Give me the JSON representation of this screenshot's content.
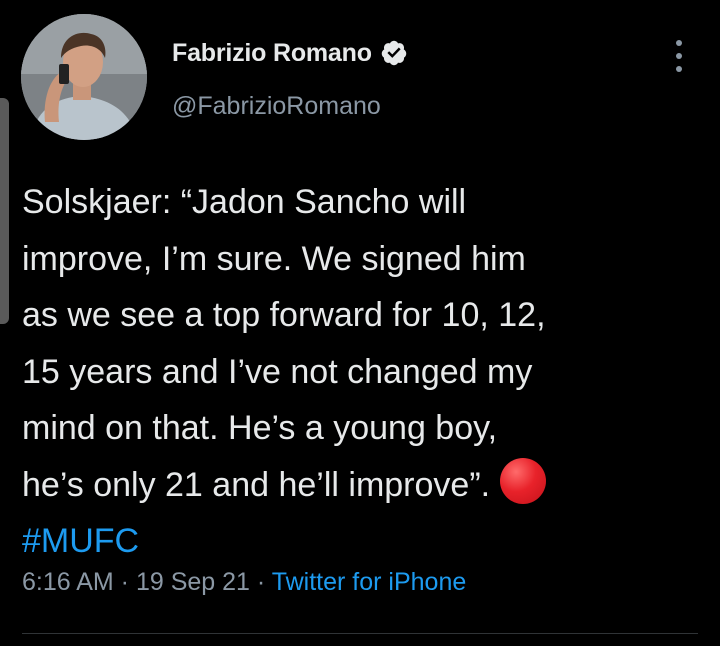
{
  "author": {
    "display_name": "Fabrizio Romano",
    "handle": "@FabrizioRomano",
    "verified": true,
    "avatar_icon": "profile-photo"
  },
  "tweet": {
    "text_lines": [
      "Solskjaer: “Jadon Sancho will",
      "improve, I’m sure. We signed him",
      "as we see a top forward for 10, 12,",
      "15 years and I’ve not changed my",
      "mind on that. He’s a young boy,",
      "he’s only 21 and he’ll improve”."
    ],
    "emoji": "red-circle",
    "hashtag": "#MUFC"
  },
  "meta": {
    "time": "6:16 AM",
    "separator1": " · ",
    "date": "19 Sep 21",
    "separator2": " · ",
    "source": "Twitter for iPhone"
  },
  "colors": {
    "background": "#000000",
    "text": "#e7e9ea",
    "secondary": "#8b98a5",
    "link": "#1d9bf0",
    "emoji_red": "#e8222a"
  }
}
